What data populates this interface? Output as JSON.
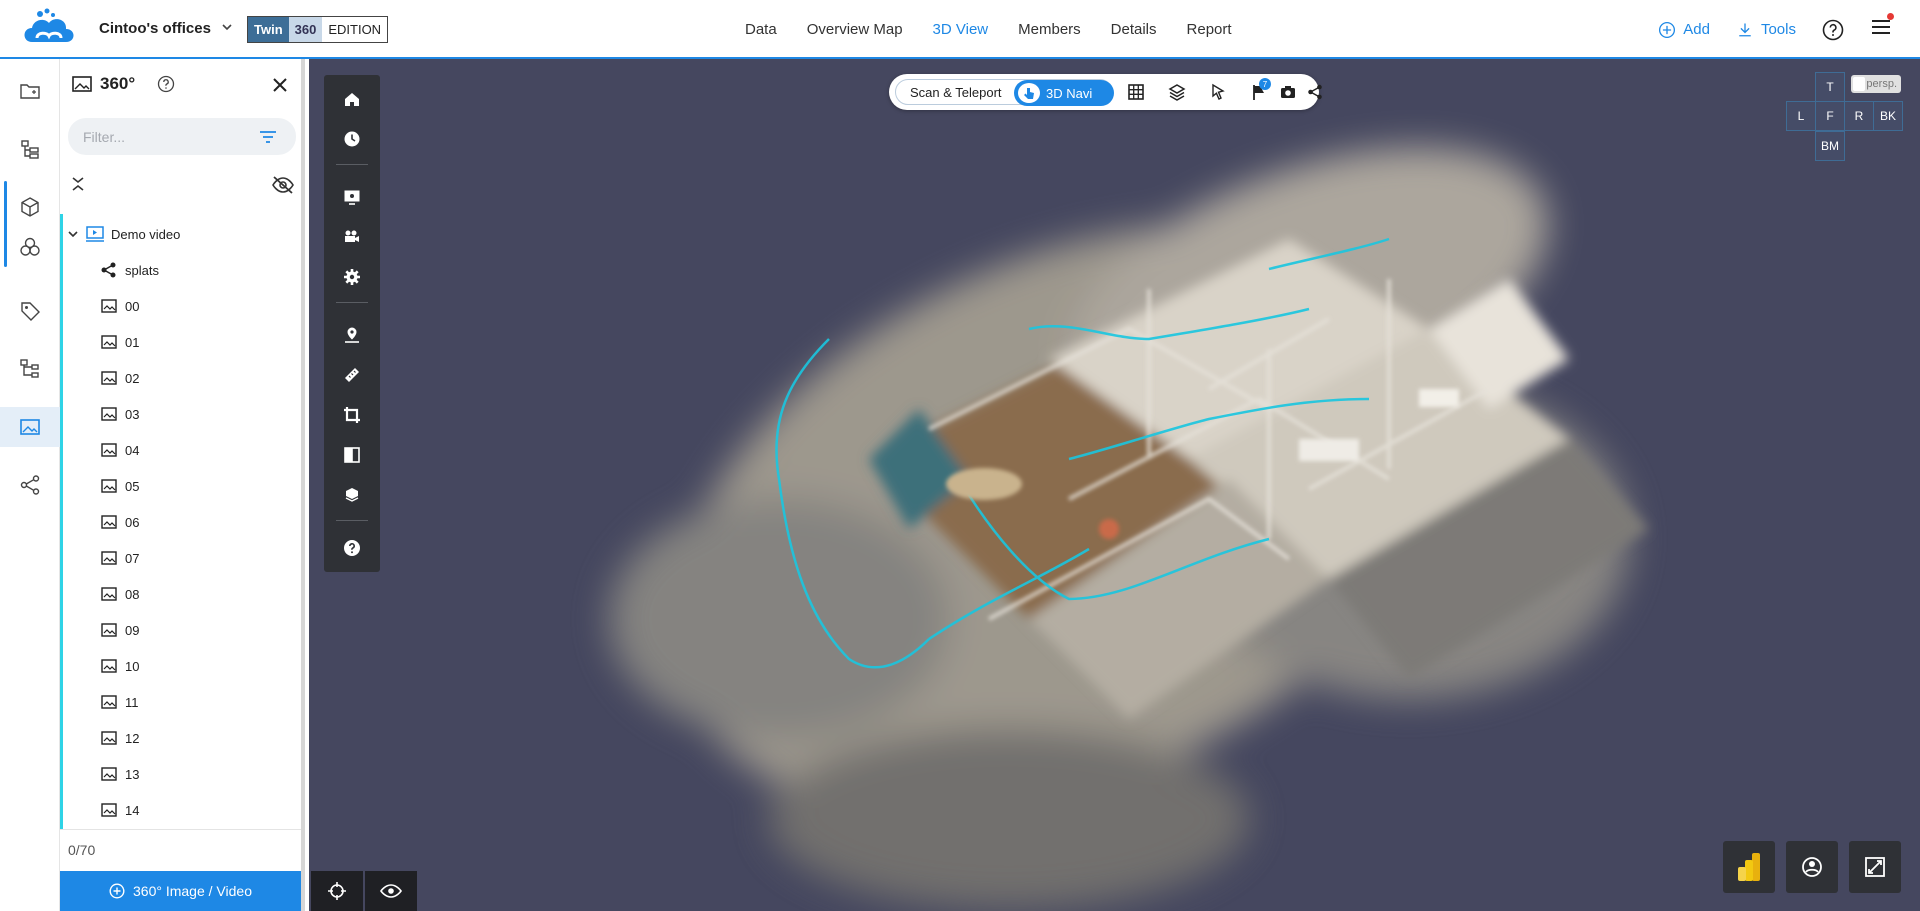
{
  "header": {
    "project_name": "Cintoo's offices",
    "edition": {
      "twin": "Twin",
      "num": "360",
      "label": "EDITION"
    },
    "nav": [
      "Data",
      "Overview Map",
      "3D View",
      "Members",
      "Details",
      "Report"
    ],
    "active_nav": "3D View",
    "add_label": "Add",
    "tools_label": "Tools",
    "accent_color": "#1e88e5"
  },
  "rail": {
    "items": [
      "folder-icon",
      "hierarchy-icon",
      "cube-icon",
      "spheres-icon",
      "tag-icon",
      "tree-structure-icon",
      "panorama-icon",
      "share-icon"
    ],
    "active": "panorama-icon"
  },
  "panel": {
    "title": "360°",
    "filter_placeholder": "Filter...",
    "root_label": "Demo video",
    "items": [
      "splats",
      "00",
      "01",
      "02",
      "03",
      "04",
      "05",
      "06",
      "07",
      "08",
      "09",
      "10",
      "11",
      "12",
      "13",
      "14"
    ],
    "count": "0/70",
    "add_button": "360° Image / Video"
  },
  "viewport": {
    "mode_scan": "Scan & Teleport",
    "mode_navi": "3D Navi",
    "flag_badge": "7",
    "view_cube": {
      "top": "T",
      "left": "L",
      "front": "F",
      "right": "R",
      "back": "BK",
      "bottom": "BM"
    },
    "projection": "persp."
  }
}
